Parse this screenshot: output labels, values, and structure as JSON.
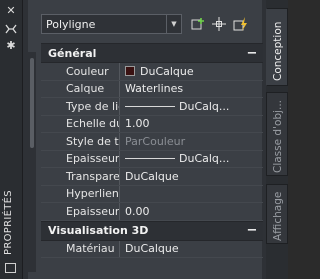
{
  "left_panel": {
    "title": "PROPRIÉTÉS",
    "icons": [
      "close-icon",
      "autohide-icon",
      "settings-icon",
      "customize-icon"
    ]
  },
  "toolbar": {
    "object_type": "Polyligne",
    "buttons": [
      "quick-select-icon",
      "select-objects-icon",
      "toggle-pickadd-icon"
    ]
  },
  "sections": [
    {
      "name": "Général",
      "toggle": "−",
      "rows": [
        {
          "label": "Couleur",
          "value": "DuCalque",
          "kind": "color",
          "color": "#3a1212"
        },
        {
          "label": "Calque",
          "value": "Waterlines",
          "kind": "text"
        },
        {
          "label": "Type de ligne",
          "value": "DuCalq...",
          "kind": "line"
        },
        {
          "label": "Echelle du t...",
          "value": "1.00",
          "kind": "text"
        },
        {
          "label": "Style de tracé",
          "value": "ParCouleur",
          "kind": "dim"
        },
        {
          "label": "Epaisseur de...",
          "value": "DuCalq...",
          "kind": "line"
        },
        {
          "label": "Transparence",
          "value": "DuCalque",
          "kind": "text"
        },
        {
          "label": "Hyperlien",
          "value": "",
          "kind": "text"
        },
        {
          "label": "Epaisseur",
          "value": "0.00",
          "kind": "text"
        }
      ]
    },
    {
      "name": "Visualisation 3D",
      "toggle": "−",
      "rows": [
        {
          "label": "Matériau",
          "value": "DuCalque",
          "kind": "text"
        }
      ]
    }
  ],
  "tabs": [
    {
      "label": "Conception",
      "active": true
    },
    {
      "label": "Classe d'obj...",
      "active": false
    },
    {
      "label": "Affichage",
      "active": false
    }
  ]
}
